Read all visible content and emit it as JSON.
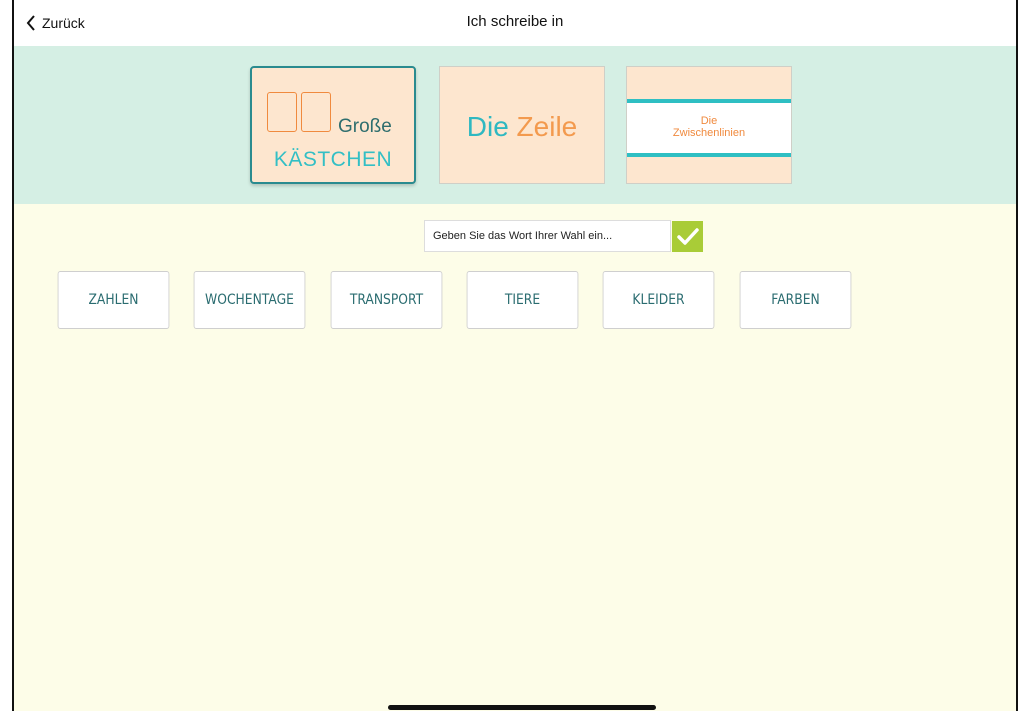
{
  "nav": {
    "back_label": "Zurück",
    "title": "Ich schreibe in"
  },
  "modes": {
    "grosse_kaestchen": {
      "line1": "Große",
      "line2": "KÄSTCHEN"
    },
    "zeile": {
      "die": "Die",
      "zeile": "Zeile"
    },
    "zwischenlinien": {
      "line1": "Die",
      "line2": "Zwischenlinien"
    }
  },
  "word_input": {
    "placeholder": "Geben Sie das Wort Ihrer Wahl ein...",
    "value": ""
  },
  "categories": [
    "ZAHLEN",
    "WOCHENTAGE",
    "TRANSPORT",
    "TIERE",
    "KLEIDER",
    "FARBEN"
  ],
  "colors": {
    "teal": "#2fb8c1",
    "orange": "#f39a4e",
    "mint_bg": "#d5efe4",
    "cream_bg": "#fdfde8",
    "check_green": "#a9cc37"
  },
  "icons": {
    "back": "chevron-left-icon",
    "confirm": "checkmark-icon"
  }
}
